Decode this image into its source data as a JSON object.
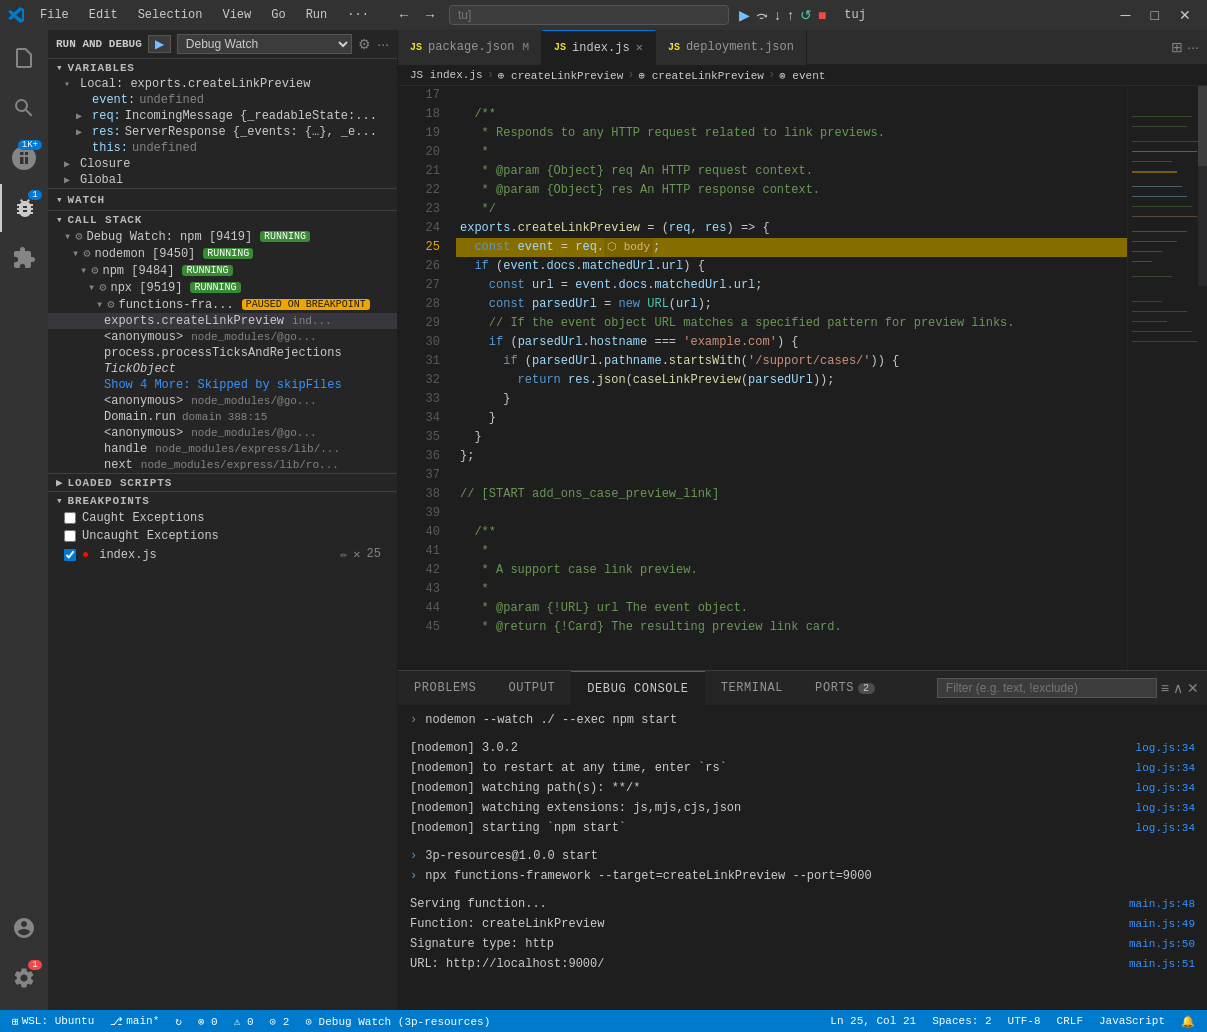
{
  "titlebar": {
    "menus": [
      "File",
      "Edit",
      "Selection",
      "View",
      "Go",
      "Run",
      "···"
    ],
    "back_label": "←",
    "forward_label": "→",
    "search_placeholder": "tu]",
    "debug_play": "▶",
    "debug_step_over": "⤼",
    "debug_step_into": "↓",
    "debug_step_out": "↑",
    "debug_restart": "↺",
    "debug_stop": "■",
    "debug_label": "tuj",
    "window_min": "─",
    "window_max": "□",
    "window_close": "✕"
  },
  "debug_bar": {
    "run_label": "RUN AND DEBUG",
    "dropdown_label": "Debug Watch",
    "play_icon": "▶"
  },
  "variables": {
    "section_label": "VARIABLES",
    "local_label": "Local: exports.createLinkPreview",
    "items": [
      {
        "name": "event:",
        "value": "undefined",
        "type": "undefined"
      },
      {
        "name": "req:",
        "value": "IncomingMessage {_readableState:...",
        "type": "object"
      },
      {
        "name": "res:",
        "value": "ServerResponse {_events: {…}, _e...",
        "type": "object"
      },
      {
        "name": "this:",
        "value": "undefined",
        "type": "undefined"
      }
    ],
    "closure_label": "Closure",
    "global_label": "Global"
  },
  "watch": {
    "section_label": "WATCH"
  },
  "call_stack": {
    "section_label": "CALL STACK",
    "items": [
      {
        "name": "Debug Watch: npm [9419]",
        "badge": "RUNNING",
        "badge_type": "running"
      },
      {
        "name": "nodemon [9450]",
        "badge": "RUNNING",
        "badge_type": "running"
      },
      {
        "name": "npm [9484]",
        "badge": "RUNNING",
        "badge_type": "running"
      },
      {
        "name": "npx [9519]",
        "badge": "RUNNING",
        "badge_type": "running"
      },
      {
        "name": "functions-fra...",
        "badge": "PAUSED ON BREAKPOINT",
        "badge_type": "paused"
      },
      {
        "name": "exports.createLinkPreview",
        "source": "ind...",
        "badge": null
      },
      {
        "name": "<anonymous>",
        "source": "node_modules/@go...",
        "badge": null
      },
      {
        "name": "process.processTicksAndRejections",
        "source": null,
        "badge": null
      },
      {
        "name": "TickObject",
        "source": null,
        "badge": null,
        "special": true
      },
      {
        "name": "Show 4 More: Skipped by skipFiles",
        "badge": null,
        "link": true
      },
      {
        "name": "<anonymous>",
        "source": "node_modules/@go...",
        "badge": null
      },
      {
        "name": "Domain.run",
        "source": "domain",
        "line": "388:15",
        "badge": null
      },
      {
        "name": "<anonymous>",
        "source": "node_modules/@go...",
        "badge": null
      },
      {
        "name": "handle",
        "source": "node_modules/express/lib/...",
        "badge": null
      },
      {
        "name": "next",
        "source": "node_modules/express/lib/ro...",
        "badge": null
      }
    ]
  },
  "loaded_scripts": {
    "section_label": "LOADED SCRIPTS"
  },
  "breakpoints": {
    "section_label": "BREAKPOINTS",
    "items": [
      {
        "label": "Caught Exceptions",
        "checked": false
      },
      {
        "label": "Uncaught Exceptions",
        "checked": false
      },
      {
        "label": "index.js",
        "checked": true,
        "file": "⊙",
        "edit": "✏",
        "remove": "✕",
        "line": "25"
      }
    ]
  },
  "tabs": [
    {
      "icon": "JS",
      "label": "package.json",
      "modifier": "M",
      "active": false,
      "closable": false
    },
    {
      "icon": "JS",
      "label": "index.js",
      "modifier": null,
      "active": true,
      "closable": true
    },
    {
      "icon": "JS",
      "label": "deployment.json",
      "modifier": null,
      "active": false,
      "closable": false
    }
  ],
  "breadcrumb": {
    "items": [
      "JS index.js",
      "⊕ createLinkPreview",
      "⊕ createLinkPreview",
      "⊗ event"
    ]
  },
  "code": {
    "lines": [
      {
        "num": 17,
        "content": ""
      },
      {
        "num": 18,
        "content": "  /**",
        "type": "comment"
      },
      {
        "num": 19,
        "content": "   * Responds to any HTTP request related to link previews.",
        "type": "comment"
      },
      {
        "num": 20,
        "content": "   *",
        "type": "comment"
      },
      {
        "num": 21,
        "content": "   * @param {Object} req An HTTP request context.",
        "type": "comment"
      },
      {
        "num": 22,
        "content": "   * @param {Object} res An HTTP response context.",
        "type": "comment"
      },
      {
        "num": 23,
        "content": "   */",
        "type": "comment"
      },
      {
        "num": 24,
        "content": "exports.createLinkPreview = (req, res) => {",
        "type": "code"
      },
      {
        "num": 25,
        "content": "  const event = req.",
        "type": "debug",
        "suffix": "⬡ body;",
        "inline": "req.body"
      },
      {
        "num": 26,
        "content": "  if (event.docs.matchedUrl.url) {",
        "type": "code"
      },
      {
        "num": 27,
        "content": "    const url = event.docs.matchedUrl.url;",
        "type": "code"
      },
      {
        "num": 28,
        "content": "    const parsedUrl = new URL(url);",
        "type": "code"
      },
      {
        "num": 29,
        "content": "    // If the event object URL matches a specified pattern for preview links.",
        "type": "comment"
      },
      {
        "num": 30,
        "content": "    if (parsedUrl.hostname === 'example.com') {",
        "type": "code"
      },
      {
        "num": 31,
        "content": "      if (parsedUrl.pathname.startsWith('/support/cases/')) {",
        "type": "code"
      },
      {
        "num": 32,
        "content": "        return res.json(caseLinkPreview(parsedUrl));",
        "type": "code"
      },
      {
        "num": 33,
        "content": "      }",
        "type": "code"
      },
      {
        "num": 34,
        "content": "    }",
        "type": "code"
      },
      {
        "num": 35,
        "content": "  }",
        "type": "code"
      },
      {
        "num": 36,
        "content": "};",
        "type": "code"
      },
      {
        "num": 37,
        "content": ""
      },
      {
        "num": 38,
        "content": "// [START add_ons_case_preview_link]",
        "type": "comment"
      },
      {
        "num": 39,
        "content": ""
      },
      {
        "num": 40,
        "content": "  /**",
        "type": "comment"
      },
      {
        "num": 41,
        "content": "   *",
        "type": "comment"
      },
      {
        "num": 42,
        "content": "   * A support case link preview.",
        "type": "comment"
      },
      {
        "num": 43,
        "content": "   *",
        "type": "comment"
      },
      {
        "num": 44,
        "content": "   * @param {!URL} url The event object.",
        "type": "comment"
      },
      {
        "num": 45,
        "content": "   * @return {!Card} The resulting preview link card.",
        "type": "comment"
      }
    ]
  },
  "panel": {
    "tabs": [
      "PROBLEMS",
      "OUTPUT",
      "DEBUG CONSOLE",
      "TERMINAL",
      "PORTS"
    ],
    "active_tab": "DEBUG CONSOLE",
    "ports_badge": "2",
    "filter_placeholder": "Filter (e.g. text, !exclude)",
    "console_lines": [
      {
        "type": "cmd",
        "text": "> nodemon --watch ./ --exec npm start",
        "link": null
      },
      {
        "type": "blank"
      },
      {
        "type": "info",
        "text": "[nodemon] 3.0.2",
        "link": "log.js:34"
      },
      {
        "type": "info",
        "text": "[nodemon] to restart at any time, enter `rs`",
        "link": "log.js:34"
      },
      {
        "type": "info",
        "text": "[nodemon] watching path(s): **/*",
        "link": "log.js:34"
      },
      {
        "type": "info",
        "text": "[nodemon] watching extensions: js,mjs,cjs,json",
        "link": "log.js:34"
      },
      {
        "type": "info",
        "text": "[nodemon] starting `npm start`",
        "link": "log.js:34"
      },
      {
        "type": "blank"
      },
      {
        "type": "cmd",
        "text": "> 3p-resources@1.0.0 start",
        "link": null
      },
      {
        "type": "cmd",
        "text": "> npx functions-framework --target=createLinkPreview --port=9000",
        "link": null
      },
      {
        "type": "blank"
      },
      {
        "type": "info",
        "text": "Serving function...",
        "link": "main.js:48"
      },
      {
        "type": "info",
        "text": "Function: createLinkPreview",
        "link": "main.js:49"
      },
      {
        "type": "info",
        "text": "Signature type: http",
        "link": "main.js:50"
      },
      {
        "type": "info",
        "text": "URL: http://localhost:9000/",
        "link": "main.js:51"
      }
    ]
  },
  "status_bar": {
    "branch": "main*",
    "sync": "↻",
    "errors": "⊗ 0",
    "warnings": "⚠ 0",
    "debug": "⊙ 2",
    "wsl": "WSL: Ubuntu",
    "cursor": "Ln 25, Col 21",
    "spaces": "Spaces: 2",
    "encoding": "UTF-8",
    "eol": "CRLF",
    "lang": "JavaScript"
  }
}
